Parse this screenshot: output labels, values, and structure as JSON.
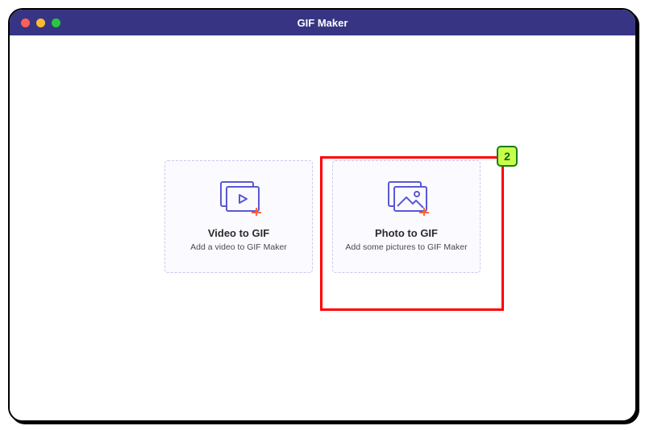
{
  "window": {
    "title": "GIF Maker"
  },
  "cards": {
    "video": {
      "title": "Video to GIF",
      "subtitle": "Add a video to GIF Maker"
    },
    "photo": {
      "title": "Photo to GIF",
      "subtitle": "Add some pictures to GIF Maker"
    }
  },
  "annotation": {
    "badge": "2"
  },
  "colors": {
    "titlebar": "#373583",
    "stroke": "#5a57d6",
    "accent": "#ff643c"
  }
}
